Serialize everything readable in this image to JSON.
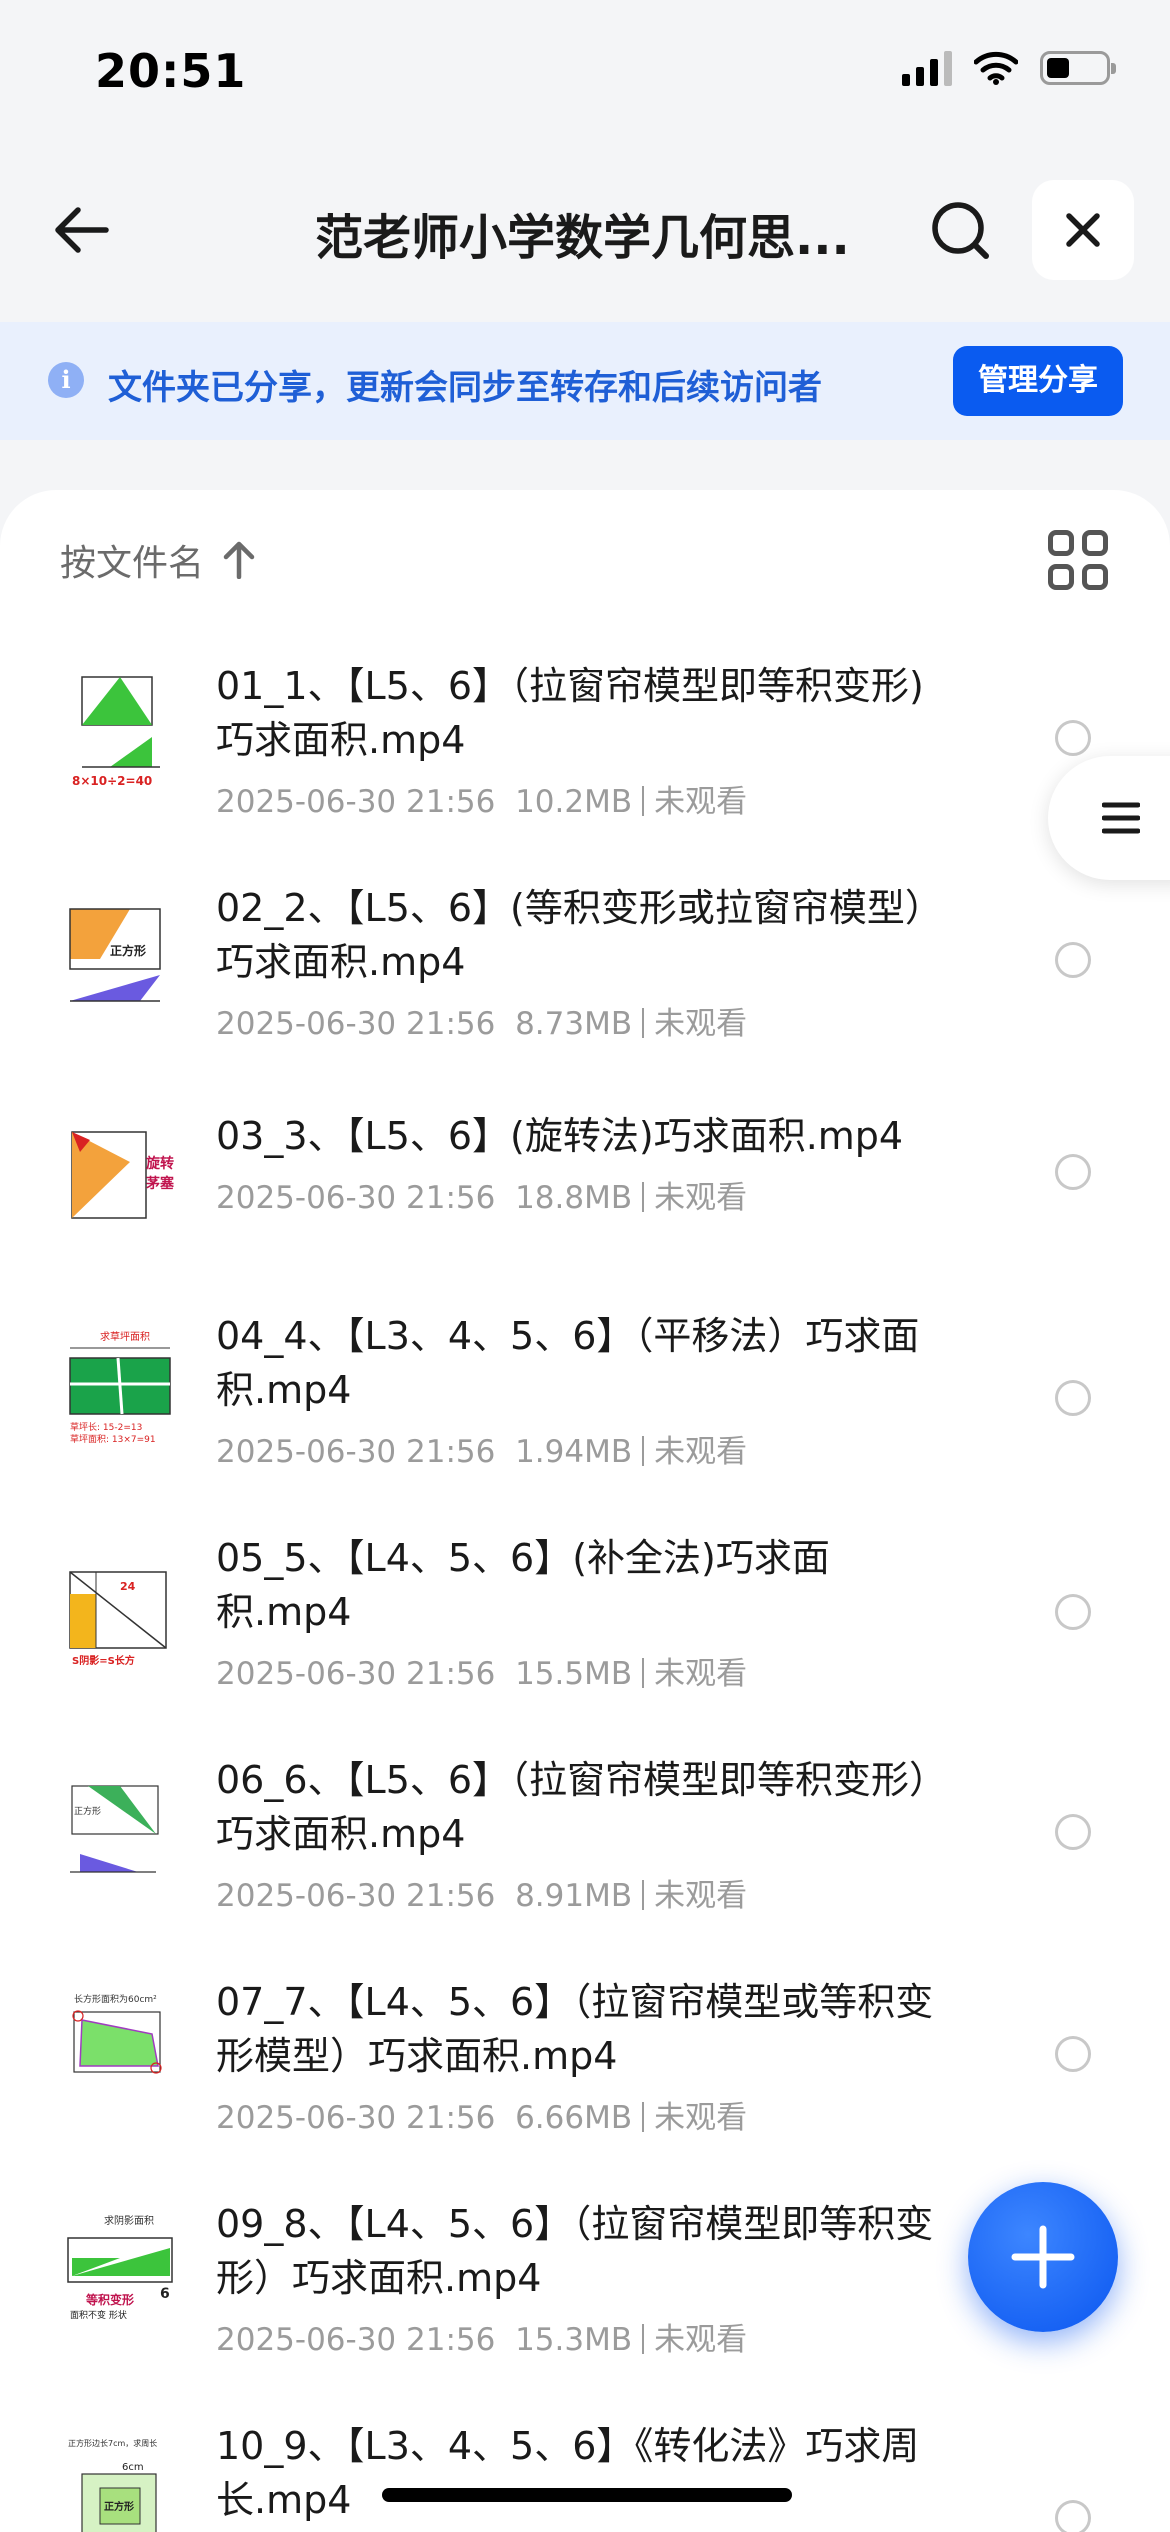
{
  "status_bar": {
    "time": "20:51"
  },
  "header": {
    "title": "范老师小学数学几何思..."
  },
  "notice": {
    "icon_glyph": "i",
    "text": "文件夹已分享，更新会同步至转存和后续访问者",
    "manage_label": "管理分享"
  },
  "sort": {
    "label": "按文件名",
    "direction": "ascending"
  },
  "files": [
    {
      "name": "01_1、【L5、6】（拉窗帘模型即等积变形)巧求面积.mp4",
      "date": "2025-06-30 21:56",
      "size": "10.2MB",
      "status": "未观看"
    },
    {
      "name": "02_2、【L5、6】(等积变形或拉窗帘模型）巧求面积.mp4",
      "date": "2025-06-30 21:56",
      "size": "8.73MB",
      "status": "未观看"
    },
    {
      "name": "03_3、【L5、6】(旋转法)巧求面积.mp4",
      "date": "2025-06-30 21:56",
      "size": "18.8MB",
      "status": "未观看"
    },
    {
      "name": "04_4、【L3、4、5、6】（平移法）巧求面积.mp4",
      "date": "2025-06-30 21:56",
      "size": "1.94MB",
      "status": "未观看"
    },
    {
      "name": "05_5、【L4、5、6】(补全法)巧求面积.mp4",
      "date": "2025-06-30 21:56",
      "size": "15.5MB",
      "status": "未观看"
    },
    {
      "name": "06_6、【L5、6】（拉窗帘模型即等积变形）巧求面积.mp4",
      "date": "2025-06-30 21:56",
      "size": "8.91MB",
      "status": "未观看"
    },
    {
      "name": "07_7、【L4、5、6】（拉窗帘模型或等积变形模型）巧求面积.mp4",
      "date": "2025-06-30 21:56",
      "size": "6.66MB",
      "status": "未观看"
    },
    {
      "name": "09_8、【L4、5、6】（拉窗帘模型即等积变形）巧求面积.mp4",
      "date": "2025-06-30 21:56",
      "size": "15.3MB",
      "status": "未观看"
    },
    {
      "name": "10_9、【L3、4、5、6】《转化法》巧求周长.mp4",
      "date": "",
      "size": "",
      "status": ""
    }
  ],
  "icons": {
    "back": "arrow-left-icon",
    "search": "search-icon",
    "close": "close-icon",
    "info": "info-icon",
    "sort_arrow": "arrow-up-icon",
    "grid": "grid-view-icon",
    "menu": "menu-icon",
    "add": "plus-icon"
  },
  "colors": {
    "accent": "#0a5bf0",
    "notice_bg": "#e9f0fd",
    "notice_text": "#1f5fd6"
  }
}
